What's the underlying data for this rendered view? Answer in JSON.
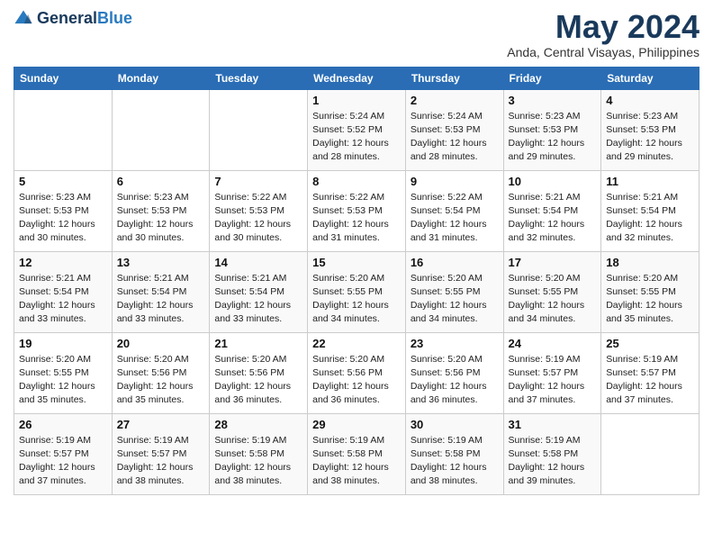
{
  "header": {
    "logo_line1": "General",
    "logo_line2": "Blue",
    "month": "May 2024",
    "location": "Anda, Central Visayas, Philippines"
  },
  "days_of_week": [
    "Sunday",
    "Monday",
    "Tuesday",
    "Wednesday",
    "Thursday",
    "Friday",
    "Saturday"
  ],
  "weeks": [
    [
      {
        "day": "",
        "info": ""
      },
      {
        "day": "",
        "info": ""
      },
      {
        "day": "",
        "info": ""
      },
      {
        "day": "1",
        "info": "Sunrise: 5:24 AM\nSunset: 5:52 PM\nDaylight: 12 hours\nand 28 minutes."
      },
      {
        "day": "2",
        "info": "Sunrise: 5:24 AM\nSunset: 5:53 PM\nDaylight: 12 hours\nand 28 minutes."
      },
      {
        "day": "3",
        "info": "Sunrise: 5:23 AM\nSunset: 5:53 PM\nDaylight: 12 hours\nand 29 minutes."
      },
      {
        "day": "4",
        "info": "Sunrise: 5:23 AM\nSunset: 5:53 PM\nDaylight: 12 hours\nand 29 minutes."
      }
    ],
    [
      {
        "day": "5",
        "info": "Sunrise: 5:23 AM\nSunset: 5:53 PM\nDaylight: 12 hours\nand 30 minutes."
      },
      {
        "day": "6",
        "info": "Sunrise: 5:23 AM\nSunset: 5:53 PM\nDaylight: 12 hours\nand 30 minutes."
      },
      {
        "day": "7",
        "info": "Sunrise: 5:22 AM\nSunset: 5:53 PM\nDaylight: 12 hours\nand 30 minutes."
      },
      {
        "day": "8",
        "info": "Sunrise: 5:22 AM\nSunset: 5:53 PM\nDaylight: 12 hours\nand 31 minutes."
      },
      {
        "day": "9",
        "info": "Sunrise: 5:22 AM\nSunset: 5:54 PM\nDaylight: 12 hours\nand 31 minutes."
      },
      {
        "day": "10",
        "info": "Sunrise: 5:21 AM\nSunset: 5:54 PM\nDaylight: 12 hours\nand 32 minutes."
      },
      {
        "day": "11",
        "info": "Sunrise: 5:21 AM\nSunset: 5:54 PM\nDaylight: 12 hours\nand 32 minutes."
      }
    ],
    [
      {
        "day": "12",
        "info": "Sunrise: 5:21 AM\nSunset: 5:54 PM\nDaylight: 12 hours\nand 33 minutes."
      },
      {
        "day": "13",
        "info": "Sunrise: 5:21 AM\nSunset: 5:54 PM\nDaylight: 12 hours\nand 33 minutes."
      },
      {
        "day": "14",
        "info": "Sunrise: 5:21 AM\nSunset: 5:54 PM\nDaylight: 12 hours\nand 33 minutes."
      },
      {
        "day": "15",
        "info": "Sunrise: 5:20 AM\nSunset: 5:55 PM\nDaylight: 12 hours\nand 34 minutes."
      },
      {
        "day": "16",
        "info": "Sunrise: 5:20 AM\nSunset: 5:55 PM\nDaylight: 12 hours\nand 34 minutes."
      },
      {
        "day": "17",
        "info": "Sunrise: 5:20 AM\nSunset: 5:55 PM\nDaylight: 12 hours\nand 34 minutes."
      },
      {
        "day": "18",
        "info": "Sunrise: 5:20 AM\nSunset: 5:55 PM\nDaylight: 12 hours\nand 35 minutes."
      }
    ],
    [
      {
        "day": "19",
        "info": "Sunrise: 5:20 AM\nSunset: 5:55 PM\nDaylight: 12 hours\nand 35 minutes."
      },
      {
        "day": "20",
        "info": "Sunrise: 5:20 AM\nSunset: 5:56 PM\nDaylight: 12 hours\nand 35 minutes."
      },
      {
        "day": "21",
        "info": "Sunrise: 5:20 AM\nSunset: 5:56 PM\nDaylight: 12 hours\nand 36 minutes."
      },
      {
        "day": "22",
        "info": "Sunrise: 5:20 AM\nSunset: 5:56 PM\nDaylight: 12 hours\nand 36 minutes."
      },
      {
        "day": "23",
        "info": "Sunrise: 5:20 AM\nSunset: 5:56 PM\nDaylight: 12 hours\nand 36 minutes."
      },
      {
        "day": "24",
        "info": "Sunrise: 5:19 AM\nSunset: 5:57 PM\nDaylight: 12 hours\nand 37 minutes."
      },
      {
        "day": "25",
        "info": "Sunrise: 5:19 AM\nSunset: 5:57 PM\nDaylight: 12 hours\nand 37 minutes."
      }
    ],
    [
      {
        "day": "26",
        "info": "Sunrise: 5:19 AM\nSunset: 5:57 PM\nDaylight: 12 hours\nand 37 minutes."
      },
      {
        "day": "27",
        "info": "Sunrise: 5:19 AM\nSunset: 5:57 PM\nDaylight: 12 hours\nand 38 minutes."
      },
      {
        "day": "28",
        "info": "Sunrise: 5:19 AM\nSunset: 5:58 PM\nDaylight: 12 hours\nand 38 minutes."
      },
      {
        "day": "29",
        "info": "Sunrise: 5:19 AM\nSunset: 5:58 PM\nDaylight: 12 hours\nand 38 minutes."
      },
      {
        "day": "30",
        "info": "Sunrise: 5:19 AM\nSunset: 5:58 PM\nDaylight: 12 hours\nand 38 minutes."
      },
      {
        "day": "31",
        "info": "Sunrise: 5:19 AM\nSunset: 5:58 PM\nDaylight: 12 hours\nand 39 minutes."
      },
      {
        "day": "",
        "info": ""
      }
    ]
  ]
}
